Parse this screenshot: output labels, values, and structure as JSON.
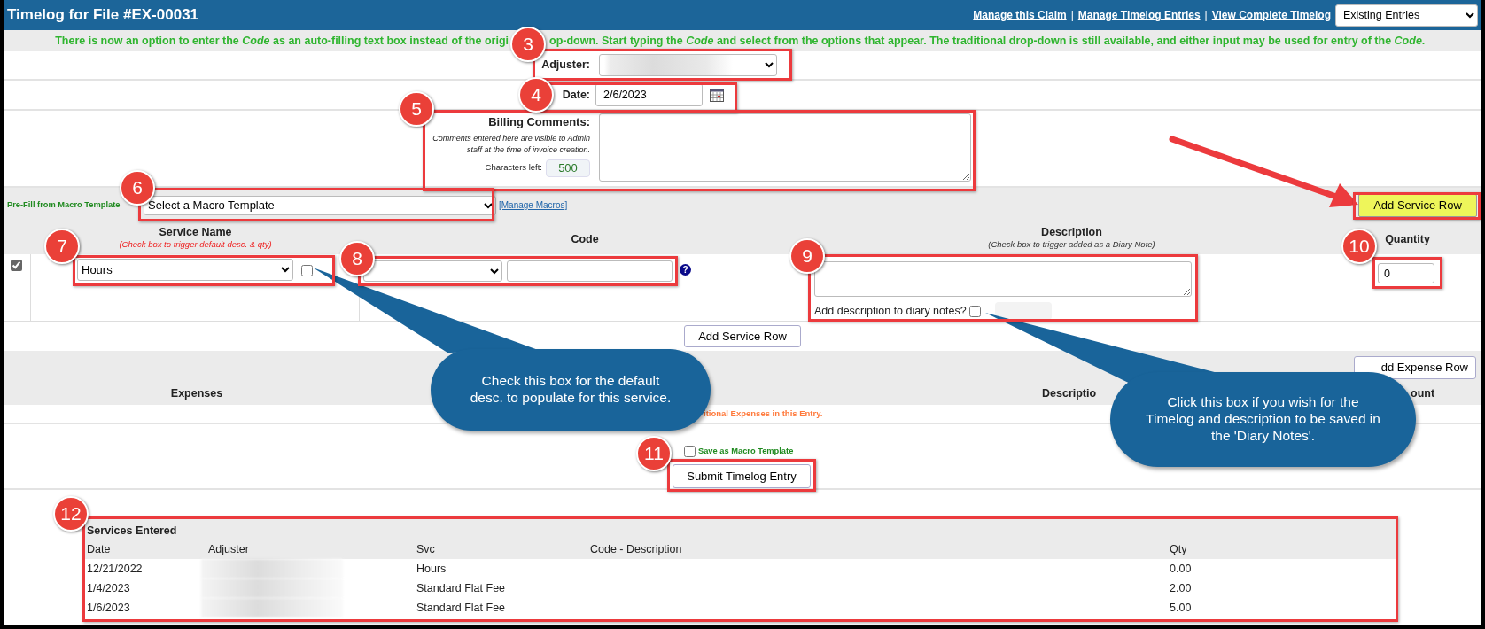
{
  "window": {
    "title": "Timelog for File #EX-00031"
  },
  "header_links": [
    {
      "label": "Manage this Claim"
    },
    {
      "label": "Manage Timelog Entries"
    },
    {
      "label": "View Complete Timelog"
    }
  ],
  "header_separators": [
    "|",
    "|"
  ],
  "view_select": "Existing Entries",
  "notice": [
    "There is now an option to enter the *Code* as an auto-filling text box instead of the origi",
    "op-down. Start typing the *Code* and select from the options that appear. The traditional drop-down is still available, and either input may be used for entry of the *Code*."
  ],
  "adjuster": {
    "label": "Adjuster:"
  },
  "date": {
    "label": "Date:",
    "value": "2/6/2023"
  },
  "billing": {
    "label": "Billing Comments:",
    "note": "Comments entered here are visible to Admin staff at the time of invoice creation.",
    "chars_label": "Characters left:",
    "chars_left": "500"
  },
  "macro": {
    "label": "Pre-Fill from Macro Template",
    "select": "Select a Macro Template",
    "manage_link": "[Manage Macros]",
    "add_service_button": {
      "label": "Add Service Row",
      "highlighted": true
    }
  },
  "service_columns": [
    {
      "title": "Service Name",
      "hint": "(Check box to trigger default desc. & qty)"
    },
    {
      "title": "Code"
    },
    {
      "title": "Description",
      "hint": "(Check box to trigger added as a Diary Note)"
    },
    {
      "title": "Quantity"
    }
  ],
  "service_row": {
    "selected": true,
    "service": "Hours",
    "default_checked": false,
    "code_help": "?",
    "diary_label": "Add description to diary notes?",
    "diary_checked": false,
    "quantity": "0"
  },
  "add_service_button": "Add Service Row",
  "expenses": {
    "add_button": "dd Expense Row",
    "columns": [
      "Expenses",
      "Descriptio",
      "ount"
    ],
    "message": "itional Expenses in this Entry."
  },
  "submit": {
    "save_macro_label": "Save as Macro Template",
    "save_macro_checked": false,
    "button": "Submit Timelog Entry"
  },
  "services_entered": {
    "title": "Services Entered",
    "columns": [
      "Date",
      "Adjuster",
      "Svc",
      "Code - Description",
      "Qty"
    ],
    "rows": [
      {
        "date": "12/21/2022",
        "svc": "Hours",
        "qty": "0.00"
      },
      {
        "date": "1/4/2023",
        "svc": "Standard Flat Fee",
        "qty": "2.00"
      },
      {
        "date": "1/6/2023",
        "svc": "Standard Flat Fee",
        "qty": "5.00"
      }
    ]
  },
  "annotations": {
    "badges": [
      "3",
      "4",
      "5",
      "6",
      "7",
      "8",
      "9",
      "10",
      "11",
      "12"
    ],
    "callouts": [
      "Check this box for the default desc. to populate for this service.",
      "Click this box if you wish for the Timelog and description to be saved in the 'Diary Notes'."
    ]
  }
}
